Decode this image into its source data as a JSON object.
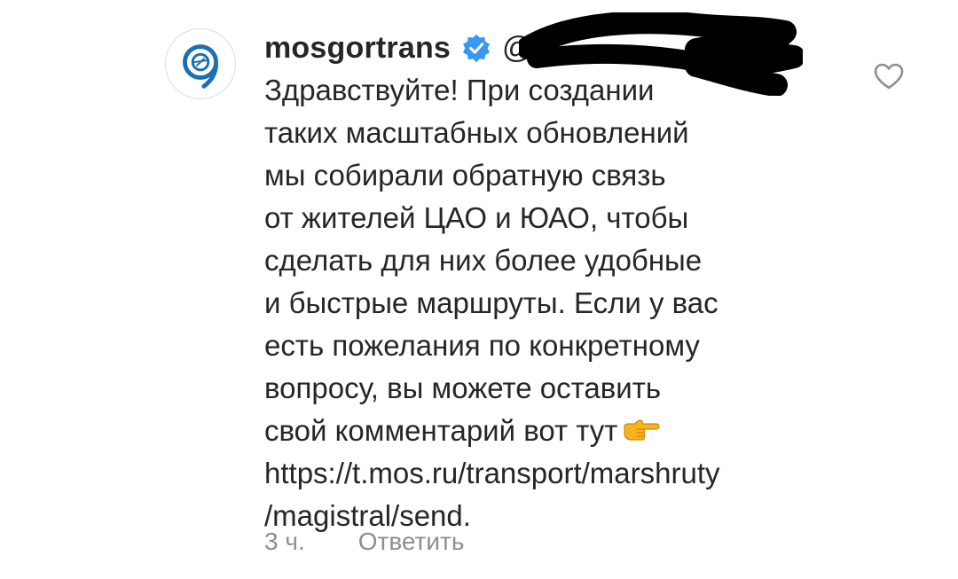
{
  "comment": {
    "username": "mosgortrans",
    "handle": "@",
    "verified_icon": "verified-badge-icon",
    "body_lines": [
      "Здравствуйте! При создании",
      "таких масштабных обновлений",
      "мы собирали обратную связь",
      "от жителей ЦАО и ЮАО, чтобы",
      "сделать для них более удобные",
      "и быстрые маршруты. Если у вас",
      "есть пожелания по конкретному",
      "вопросу, вы можете оставить",
      "свой комментарий вот тут",
      "https://t.mos.ru/transport/marshruty",
      "/magistral/send."
    ],
    "pointing_emoji_icon": "pointing-right-emoji-icon",
    "time": "3 ч.",
    "reply_label": "Ответить",
    "like_icon": "heart-outline-icon",
    "avatar_icon": "mosgortrans-logo-icon"
  },
  "colors": {
    "text": "#262626",
    "muted": "#8e8e8e",
    "verified": "#3897f0",
    "brand": "#1a6fb5"
  }
}
